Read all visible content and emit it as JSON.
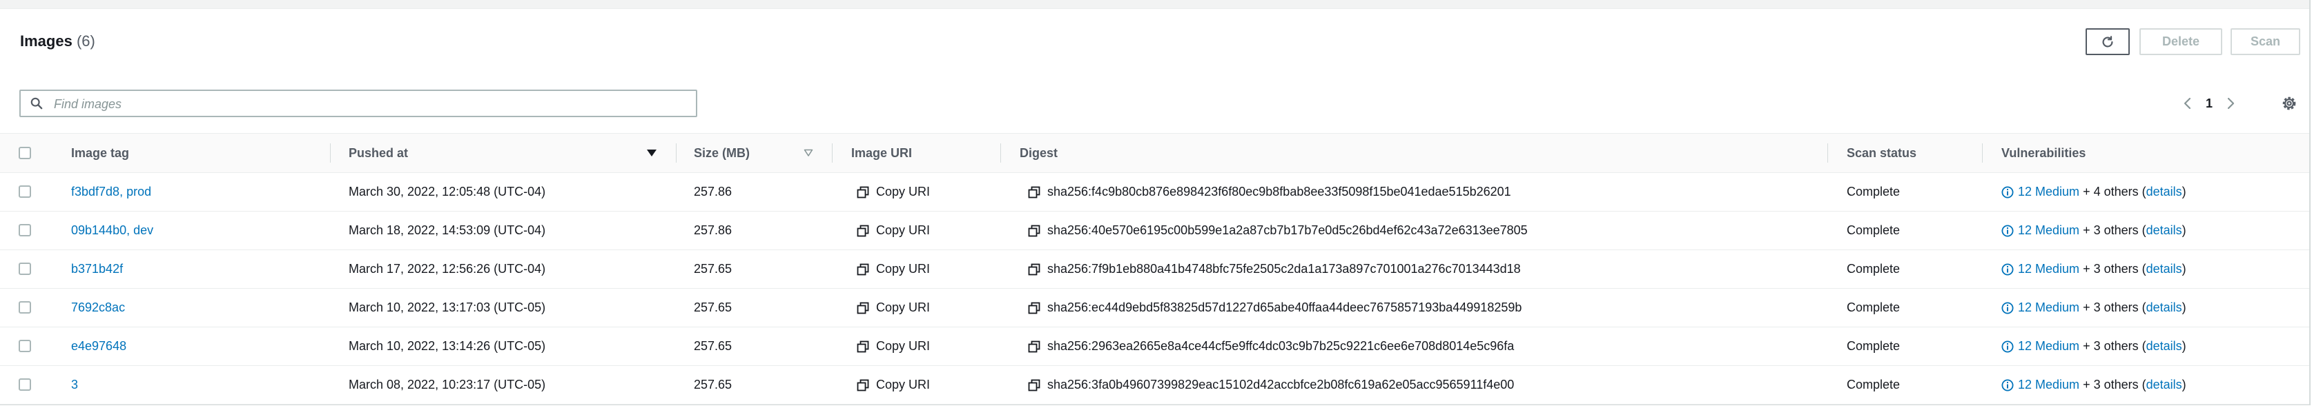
{
  "header": {
    "title": "Images",
    "count": "(6)",
    "delete_label": "Delete",
    "scan_label": "Scan"
  },
  "search": {
    "placeholder": "Find images",
    "value": ""
  },
  "pagination": {
    "current_page": "1"
  },
  "columns": {
    "image_tag": "Image tag",
    "pushed_at": "Pushed at",
    "size": "Size (MB)",
    "image_uri": "Image URI",
    "digest": "Digest",
    "scan_status": "Scan status",
    "vulnerabilities": "Vulnerabilities"
  },
  "sort": {
    "pushed_at": "descending"
  },
  "rows": [
    {
      "tag": "f3bdf7d8, prod",
      "pushed": "March 30, 2022, 12:05:48 (UTC-04)",
      "size": "257.86",
      "uri": "Copy URI",
      "digest": "sha256:f4c9b80cb876e898423f6f80ec9b8fbab8ee33f5098f15be041edae515b26201",
      "status": "Complete",
      "vuln_link": "12 Medium",
      "vuln_others": "+ 4 others (",
      "details": "details",
      "vuln_close": ")"
    },
    {
      "tag": "09b144b0, dev",
      "pushed": "March 18, 2022, 14:53:09 (UTC-04)",
      "size": "257.86",
      "uri": "Copy URI",
      "digest": "sha256:40e570e6195c00b599e1a2a87cb7b17b7e0d5c26bd4ef62c43a72e6313ee7805",
      "status": "Complete",
      "vuln_link": "12 Medium",
      "vuln_others": "+ 3 others (",
      "details": "details",
      "vuln_close": ")"
    },
    {
      "tag": "b371b42f",
      "pushed": "March 17, 2022, 12:56:26 (UTC-04)",
      "size": "257.65",
      "uri": "Copy URI",
      "digest": "sha256:7f9b1eb880a41b4748bfc75fe2505c2da1a173a897c701001a276c7013443d18",
      "status": "Complete",
      "vuln_link": "12 Medium",
      "vuln_others": "+ 3 others (",
      "details": "details",
      "vuln_close": ")"
    },
    {
      "tag": "7692c8ac",
      "pushed": "March 10, 2022, 13:17:03 (UTC-05)",
      "size": "257.65",
      "uri": "Copy URI",
      "digest": "sha256:ec44d9ebd5f83825d57d1227d65abe40ffaa44deec7675857193ba449918259b",
      "status": "Complete",
      "vuln_link": "12 Medium",
      "vuln_others": "+ 3 others (",
      "details": "details",
      "vuln_close": ")"
    },
    {
      "tag": "e4e97648",
      "pushed": "March 10, 2022, 13:14:26 (UTC-05)",
      "size": "257.65",
      "uri": "Copy URI",
      "digest": "sha256:2963ea2665e8a4ce44cf5e9ffc4dc03c9b7b25c9221c6ee6e708d8014e5c96fa",
      "status": "Complete",
      "vuln_link": "12 Medium",
      "vuln_others": "+ 3 others (",
      "details": "details",
      "vuln_close": ")"
    },
    {
      "tag": "3",
      "pushed": "March 08, 2022, 10:23:17 (UTC-05)",
      "size": "257.65",
      "uri": "Copy URI",
      "digest": "sha256:3fa0b49607399829eac15102d42accbfce2b08fc619a62e05acc9565911f4e00",
      "status": "Complete",
      "vuln_link": "12 Medium",
      "vuln_others": "+ 3 others (",
      "details": "details",
      "vuln_close": ")"
    }
  ],
  "icons": {
    "refresh": "refresh-icon",
    "search": "search-icon",
    "prev": "chevron-left-icon",
    "next": "chevron-right-icon",
    "settings": "gear-icon",
    "copy": "copy-icon",
    "info": "info-icon",
    "sort": "caret-down-icon"
  },
  "colors": {
    "link": "#0073bb",
    "text": "#16191f",
    "muted": "#545b64",
    "border": "#d5dbdb"
  }
}
